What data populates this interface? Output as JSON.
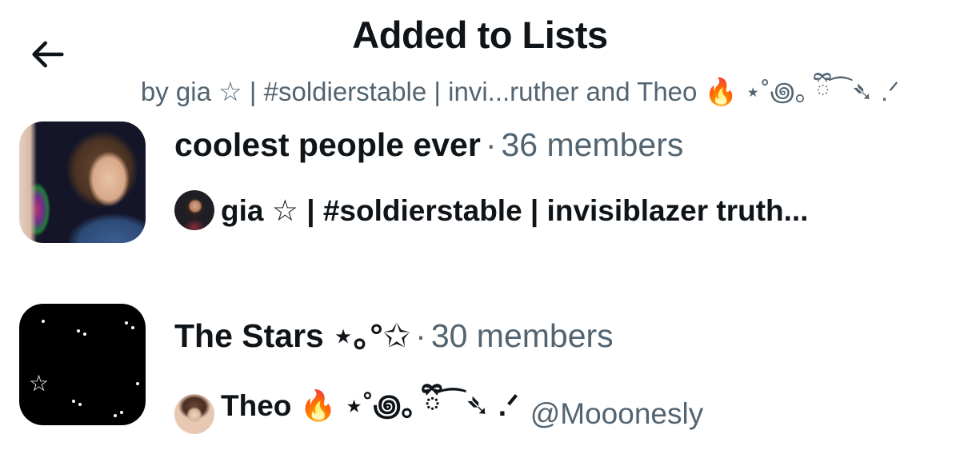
{
  "header": {
    "title": "Added to Lists",
    "subtitle": "by gia ☆ | #soldierstable | invi...ruther and Theo 🔥 ⋆˚꩜｡ ྀི⁀➴ .ᐟ",
    "back_icon": "arrow-left-icon"
  },
  "lists": [
    {
      "name": "coolest people ever",
      "separator": "·",
      "members": "36 members",
      "owner": {
        "name": "gia ☆ | #soldierstable | invisiblazer truth...",
        "handle": ""
      }
    },
    {
      "name": "The Stars ⋆｡°✩",
      "separator": "·",
      "members": "30 members",
      "owner": {
        "name": "Theo 🔥 ⋆˚꩜｡ ྀི⁀➴ .ᐟ",
        "handle": "@Mooonesly"
      }
    }
  ],
  "colors": {
    "text_primary": "#0f1419",
    "text_secondary": "#536471",
    "background": "#ffffff"
  }
}
